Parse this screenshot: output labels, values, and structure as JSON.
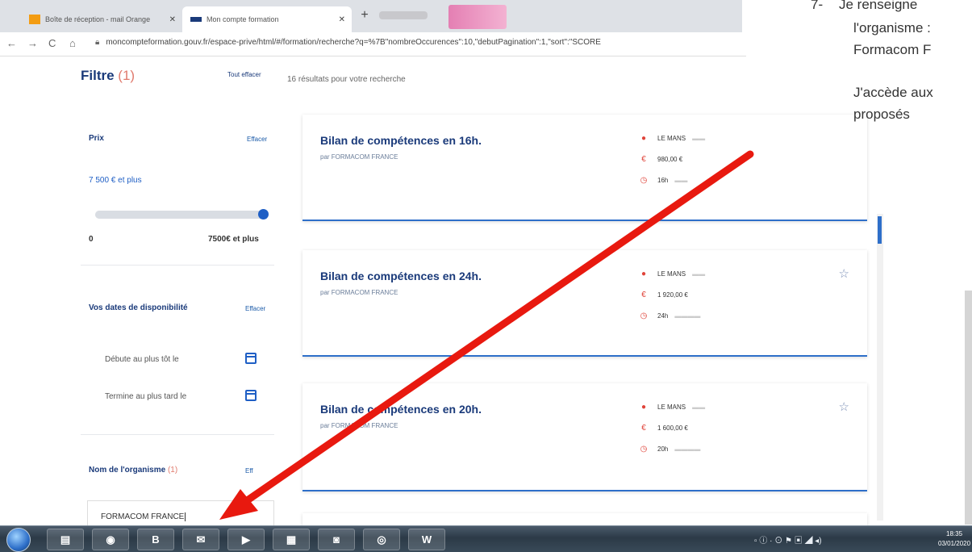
{
  "browser": {
    "tabs": [
      {
        "label": "Boîte de réception - mail Orange",
        "close": "✕",
        "icon": "orange-mail-icon",
        "icon_color": "#f39c12"
      },
      {
        "label": "Mon compte formation",
        "close": "✕",
        "icon": "mcf-logo-icon",
        "icon_color": "#1a3a7a"
      }
    ],
    "new_tab": "+",
    "nav": {
      "back": "←",
      "forward": "→",
      "reload": "C",
      "home": "⌂"
    },
    "url": "moncompteformation.gouv.fr/espace-prive/html/#/formation/recherche?q=%7B\"nombreOccurences\":10,\"debutPagination\":1,\"sort\":\"SCORE"
  },
  "filters": {
    "title": "Filtre",
    "count": "(1)",
    "clear_all": "Tout effacer",
    "results_text": "16 résultats pour votre recherche",
    "price": {
      "label": "Prix",
      "clear": "Effacer",
      "value_text": "7 500 € et plus",
      "min_label": "0",
      "max_label": "7500€ et plus",
      "slider_level": 1.0
    },
    "dates": {
      "label": "Vos dates de disponibilité",
      "clear": "Effacer",
      "start_label": "Débute au plus tôt le",
      "end_label": "Termine au plus tard le"
    },
    "organisme": {
      "label": "Nom de l'organisme",
      "count": "(1)",
      "clear": "Eff",
      "value": "FORMACOM FRANCE"
    }
  },
  "results": [
    {
      "title": "Bilan de compétences en 16h.",
      "org": "par FORMACOM FRANCE",
      "city": "LE MANS",
      "price": "980,00 €",
      "duration": "16h"
    },
    {
      "title": "Bilan de compétences en 24h.",
      "org": "par FORMACOM FRANCE",
      "city": "LE MANS",
      "price": "1 920,00 €",
      "duration": "24h"
    },
    {
      "title": "Bilan de compétences en 20h.",
      "org": "par FORMACOM FRANCE",
      "city": "LE MANS",
      "price": "1 600,00 €",
      "duration": "20h"
    }
  ],
  "instructions": {
    "number": "7-",
    "line1": "Je renseigne",
    "line2": "l'organisme :",
    "line3": "Formacom F",
    "line4": "J'accède aux",
    "line5": "proposés"
  },
  "taskbar": {
    "items": [
      {
        "icon": "explorer-icon",
        "glyph": "▤"
      },
      {
        "icon": "chrome-icon",
        "glyph": "◉"
      },
      {
        "icon": "b-app-icon",
        "glyph": "B"
      },
      {
        "icon": "outlook-icon",
        "glyph": "✉"
      },
      {
        "icon": "zoom-icon",
        "glyph": "▶"
      },
      {
        "icon": "pictures-icon",
        "glyph": "▦"
      },
      {
        "icon": "camera-icon",
        "glyph": "◙"
      },
      {
        "icon": "media-icon",
        "glyph": "◎"
      },
      {
        "icon": "word-icon",
        "glyph": "W"
      }
    ],
    "tray": "▫ ⓘ · ⊙ ⚑ ▣ ◢ ◂)",
    "clock_time": "18:35",
    "clock_date": "03/01/2020"
  },
  "colors": {
    "accent": "#1a3a7a",
    "link": "#1f5fc5",
    "arrow": "#e8190f",
    "pin": "#e0443a"
  }
}
